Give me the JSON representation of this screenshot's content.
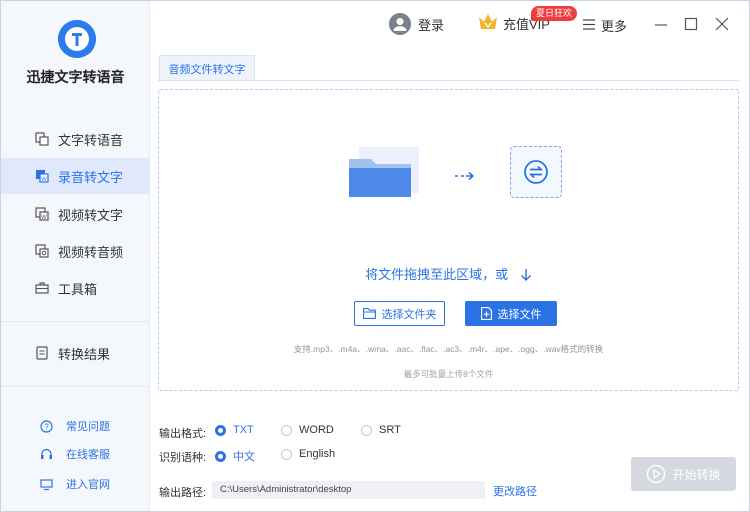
{
  "app": {
    "name": "迅捷文字转语音"
  },
  "nav": [
    {
      "label": "文字转语音",
      "icon": "text-to-speech-icon"
    },
    {
      "label": "录音转文字",
      "icon": "audio-to-text-icon"
    },
    {
      "label": "视频转文字",
      "icon": "video-to-text-icon"
    },
    {
      "label": "视频转音频",
      "icon": "video-to-audio-icon"
    },
    {
      "label": "工具箱",
      "icon": "toolbox-icon"
    },
    {
      "label": "转换结果",
      "icon": "result-icon"
    }
  ],
  "help": [
    {
      "label": "常见问题",
      "icon": "question-icon"
    },
    {
      "label": "在线客服",
      "icon": "headset-icon"
    },
    {
      "label": "进入官网",
      "icon": "monitor-icon"
    }
  ],
  "topbar": {
    "login": "登录",
    "vip": "充值VIP",
    "vip_badge": "夏日狂欢",
    "more": "更多"
  },
  "tab": {
    "label": "音频文件转文字"
  },
  "dropzone": {
    "text": "将文件拖拽至此区域，或",
    "btn_folder": "选择文件夹",
    "btn_file": "选择文件",
    "support": "支持.mp3、.m4a、.wma、.aac、.flac、.ac3、.m4r、.ape、.ogg、.wav格式的转换",
    "limit": "最多可批量上传8个文件"
  },
  "options": {
    "format_label": "输出格式:",
    "formats": [
      "TXT",
      "WORD",
      "SRT"
    ],
    "selected_format": "TXT",
    "language_label": "识别语种:",
    "languages": [
      "中文",
      "English"
    ],
    "selected_language": "中文",
    "path_label": "输出路径:",
    "path": "C:\\Users\\Administrator\\desktop",
    "change_path": "更改路径"
  },
  "start_button": "开始转换",
  "colors": {
    "accent": "#2b73e5",
    "badge": "#ef3d3d",
    "disabled": "#d5d9df"
  }
}
